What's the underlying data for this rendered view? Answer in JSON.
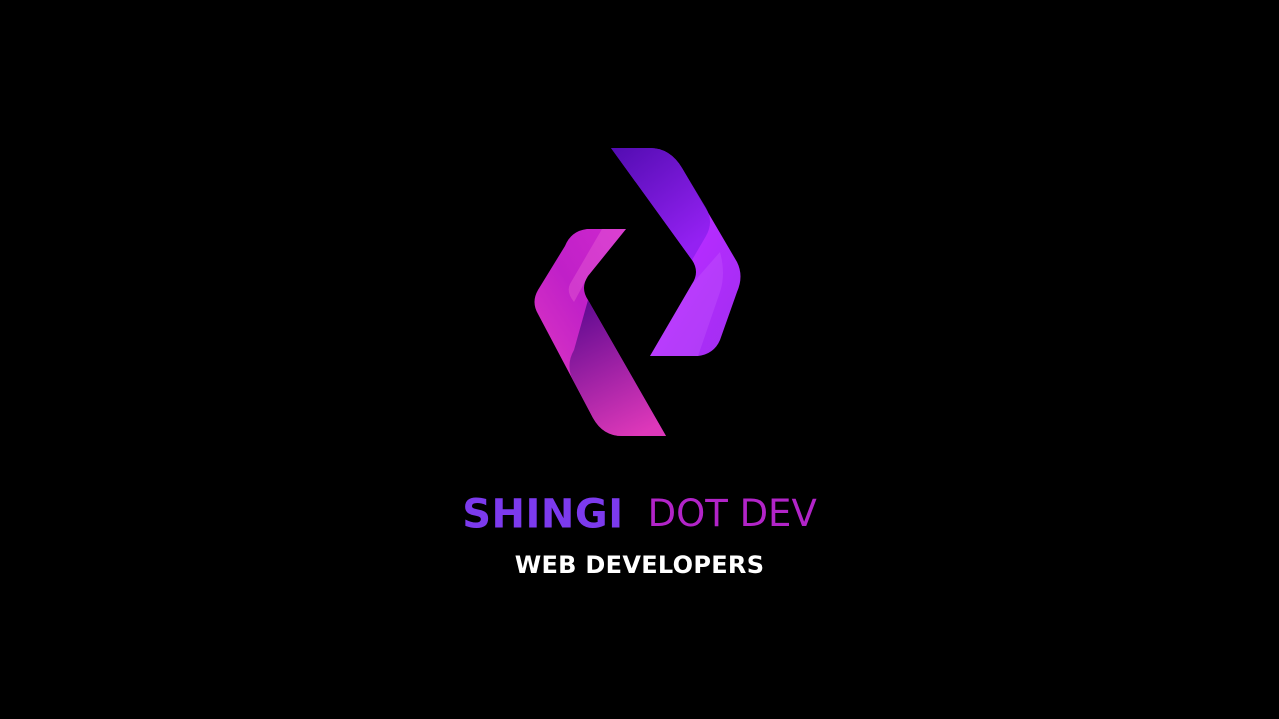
{
  "brand": {
    "name_primary": "SHINGI",
    "name_secondary": "DOT DEV",
    "tagline": "WEB DEVELOPERS",
    "logo_icon": "diamond-chevron-logo-icon"
  },
  "colors": {
    "background": "#000000",
    "primary_purple": "#7c3aed",
    "secondary_magenta": "#b224c8",
    "tagline_white": "#ffffff",
    "logo_right_light": "#c13bff",
    "logo_right_dark": "#6a10d8",
    "logo_left_light": "#e93cc0",
    "logo_left_dark": "#b51ec9"
  }
}
